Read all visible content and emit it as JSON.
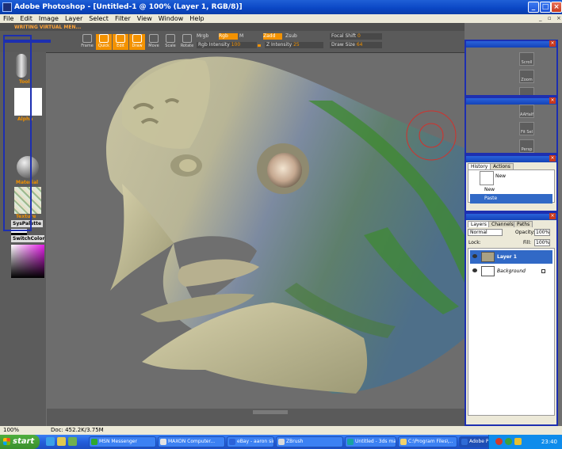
{
  "window": {
    "title": "Adobe Photoshop - [Untitled-1 @ 100% (Layer 1, RGB/8)]",
    "minimize": "_",
    "maximize": "□",
    "close": "×"
  },
  "menu": [
    "File",
    "Edit",
    "Image",
    "Layer",
    "Select",
    "Filter",
    "View",
    "Window",
    "Help"
  ],
  "zbrush": {
    "virtual_menu": "WRITING VIRTUAL MEN...",
    "tools": [
      {
        "label": "Frame",
        "active": false
      },
      {
        "label": "Quick",
        "active": true
      },
      {
        "label": "Edit",
        "active": true
      },
      {
        "label": "Draw",
        "active": true
      },
      {
        "label": "Move",
        "active": false
      },
      {
        "label": "Scale",
        "active": false
      },
      {
        "label": "Rotate",
        "active": false
      }
    ],
    "mrgb": "Mrgb",
    "rgb": "Rgb",
    "m": "M",
    "zadd": "Zadd",
    "zsub": "Zsub",
    "focal_shift": "Focal Shift",
    "focal_shift_value": "0",
    "rgb_intensity_label": "Rgb Intensity",
    "rgb_intensity_value": "100",
    "z_intensity_label": "Z Intensity",
    "z_intensity_value": "25",
    "draw_size_label": "Draw Size",
    "draw_size_value": "64",
    "left_labels": {
      "tool": "Tool",
      "alpha": "Alpha",
      "material": "Material",
      "texture": "Texture",
      "syspalette": "SysPalette",
      "switchcolor": "SwitchColor"
    },
    "right_buttons": [
      "Scroll",
      "Zoom",
      "Move",
      "AAHalf",
      "Fit Sel",
      "Persp"
    ]
  },
  "history": {
    "tabs": [
      "History",
      "Actions"
    ],
    "snapshot": "New",
    "items": [
      "New",
      "Paste"
    ],
    "selected": "Paste"
  },
  "layers": {
    "tabs": [
      "Layers",
      "Channels",
      "Paths"
    ],
    "blend_mode": "Normal",
    "opacity_label": "Opacity:",
    "opacity_value": "100%",
    "lock_label": "Lock:",
    "fill_label": "Fill:",
    "fill_value": "100%",
    "items": [
      {
        "name": "Layer 1",
        "selected": true
      },
      {
        "name": "Background",
        "selected": false
      }
    ]
  },
  "status": {
    "zoom": "100%",
    "doc": "Doc: 452.2K/3.75M"
  },
  "taskbar": {
    "start": "start",
    "tasks": [
      {
        "label": "MSN Messenger",
        "icon_color": "#2ea82e"
      },
      {
        "label": "MAXON Computer...",
        "icon_color": "#e3e3e3"
      },
      {
        "label": "eBay - aaron sims...",
        "icon_color": "#2b62d9"
      },
      {
        "label": "ZBrush",
        "icon_color": "#d9d9d9"
      },
      {
        "label": "Untitled - 3ds ma...",
        "icon_color": "#18a3a3"
      },
      {
        "label": "C:\\Program Files\\...",
        "icon_color": "#f2d26b"
      },
      {
        "label": "Adobe Photoshop...",
        "icon_color": "#2f6bd6"
      }
    ],
    "clock": "23:40"
  }
}
